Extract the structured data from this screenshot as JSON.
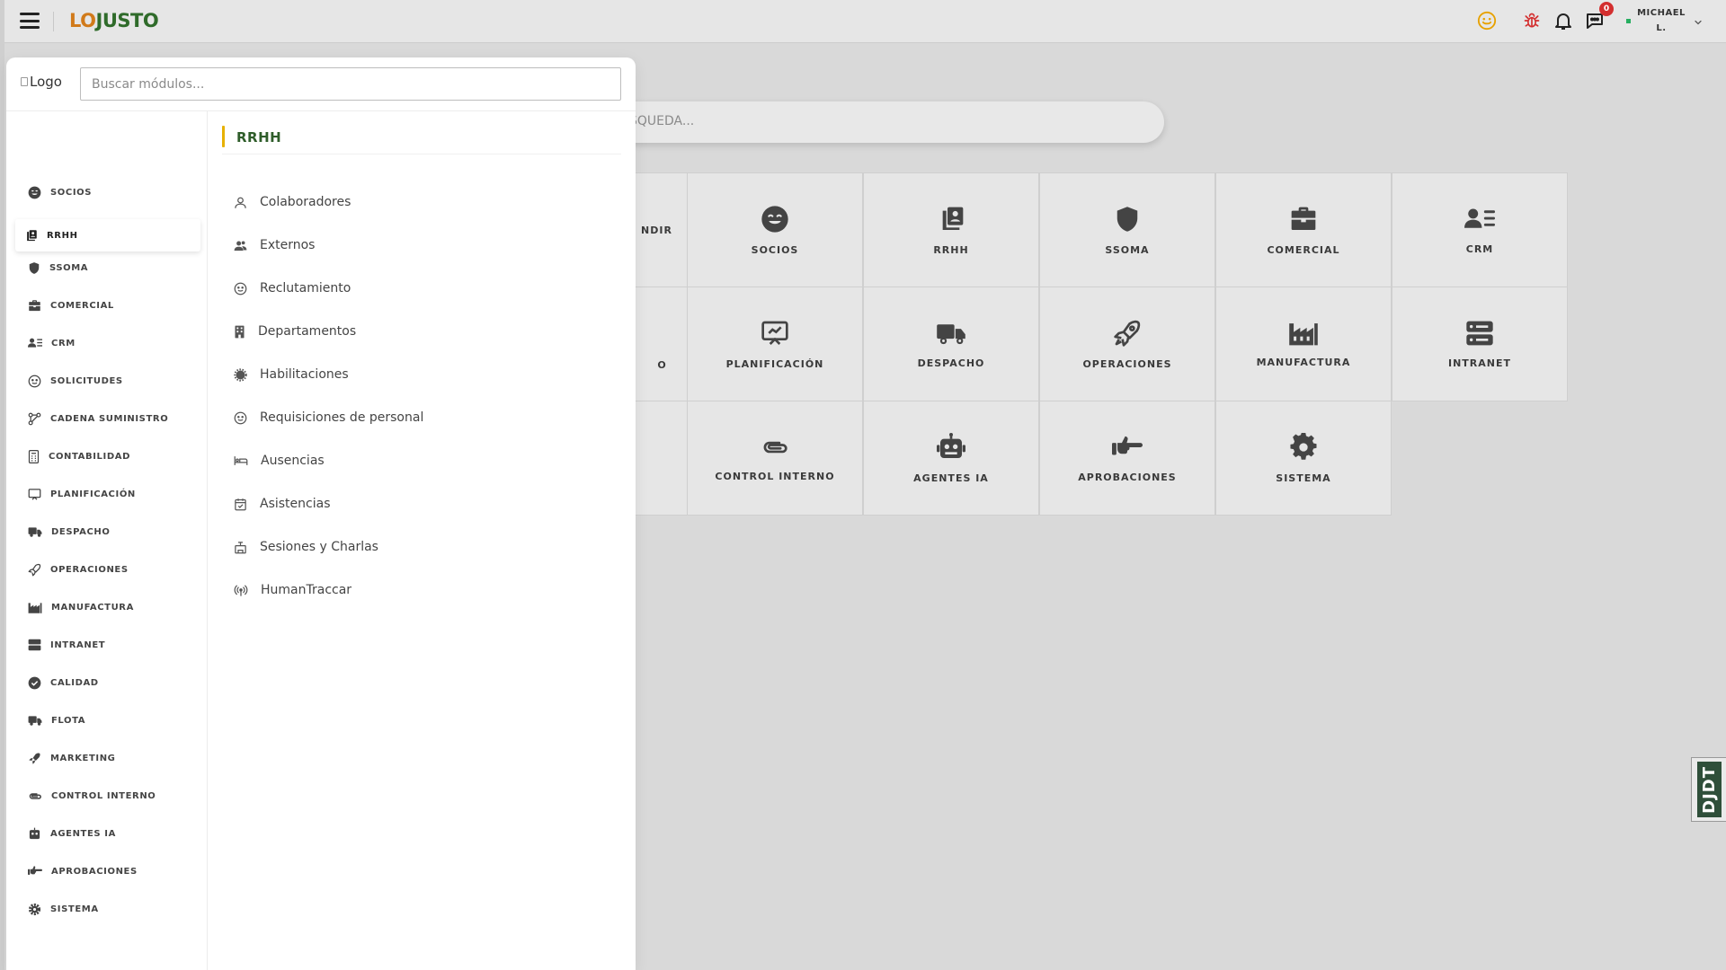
{
  "topbar": {
    "brand_part1": "LO",
    "brand_part2": "JUSTO",
    "notifications_badge": "0",
    "user_name_line1": "MICHAEL",
    "user_name_line2": "L."
  },
  "background": {
    "search_placeholder_visible": "SQUEDA...",
    "tiles": [
      {
        "label": "NDIR",
        "icon": "partial-icon"
      },
      {
        "label": "SOCIOS",
        "icon": "smile-icon"
      },
      {
        "label": "RRHH",
        "icon": "id-card-icon"
      },
      {
        "label": "SSOMA",
        "icon": "shield-icon"
      },
      {
        "label": "COMERCIAL",
        "icon": "briefcase-icon"
      },
      {
        "label": "CRM",
        "icon": "user-list-icon"
      },
      {
        "label": "O",
        "icon": "partial-icon"
      },
      {
        "label": "PLANIFICACIÓN",
        "icon": "presentation-icon"
      },
      {
        "label": "DESPACHO",
        "icon": "truck-icon"
      },
      {
        "label": "OPERACIONES",
        "icon": "rocket-icon"
      },
      {
        "label": "MANUFACTURA",
        "icon": "factory-icon"
      },
      {
        "label": "INTRANET",
        "icon": "server-icon"
      },
      {
        "label": "",
        "icon": "partial-icon"
      },
      {
        "label": "CONTROL INTERNO",
        "icon": "paperclip-icon"
      },
      {
        "label": "AGENTES IA",
        "icon": "robot-icon"
      },
      {
        "label": "APROBACIONES",
        "icon": "hand-point-icon"
      },
      {
        "label": "SISTEMA",
        "icon": "gear-icon"
      }
    ]
  },
  "panel": {
    "logo_alt": "Logo",
    "search_placeholder": "Buscar módulos...",
    "nav": [
      {
        "label": "SOCIOS",
        "icon": "smile-icon"
      },
      {
        "label": "RRHH",
        "icon": "id-card-icon",
        "active": true
      },
      {
        "label": "SSOMA",
        "icon": "shield-icon"
      },
      {
        "label": "COMERCIAL",
        "icon": "briefcase-icon"
      },
      {
        "label": "CRM",
        "icon": "user-list-icon"
      },
      {
        "label": "SOLICITUDES",
        "icon": "smile-outline-icon"
      },
      {
        "label": "CADENA SUMINISTRO",
        "icon": "network-icon"
      },
      {
        "label": "CONTABILIDAD",
        "icon": "calculator-icon"
      },
      {
        "label": "PLANIFICACIÓN",
        "icon": "presentation-icon"
      },
      {
        "label": "DESPACHO",
        "icon": "truck-icon"
      },
      {
        "label": "OPERACIONES",
        "icon": "rocket-icon"
      },
      {
        "label": "MANUFACTURA",
        "icon": "factory-icon"
      },
      {
        "label": "INTRANET",
        "icon": "server-icon"
      },
      {
        "label": "CALIDAD",
        "icon": "check-badge-icon"
      },
      {
        "label": "FLOTA",
        "icon": "truck-icon"
      },
      {
        "label": "MARKETING",
        "icon": "rocket-icon"
      },
      {
        "label": "CONTROL INTERNO",
        "icon": "paperclip-icon"
      },
      {
        "label": "AGENTES IA",
        "icon": "robot-icon"
      },
      {
        "label": "APROBACIONES",
        "icon": "hand-point-icon"
      },
      {
        "label": "SISTEMA",
        "icon": "gear-icon"
      }
    ],
    "sub_title": "RRHH",
    "sub_items": [
      {
        "label": "Colaboradores",
        "icon": "user-outline-icon"
      },
      {
        "label": "Externos",
        "icon": "users-icon"
      },
      {
        "label": "Reclutamiento",
        "icon": "smile-outline-icon"
      },
      {
        "label": "Departamentos",
        "icon": "building-icon"
      },
      {
        "label": "Habilitaciones",
        "icon": "badge-icon"
      },
      {
        "label": "Requisiciones de personal",
        "icon": "smile-outline-icon"
      },
      {
        "label": "Ausencias",
        "icon": "bed-icon"
      },
      {
        "label": "Asistencias",
        "icon": "calendar-check-icon"
      },
      {
        "label": "Sesiones y Charlas",
        "icon": "presentation-box-icon"
      },
      {
        "label": "HumanTraccar",
        "icon": "broadcast-icon"
      }
    ]
  },
  "djdt": {
    "label": "DJDT"
  },
  "colors": {
    "brand_orange": "#d17a1a",
    "brand_green": "#2f6b2a",
    "accent_yellow": "#e7b100",
    "badge_red": "#d32f2f"
  }
}
